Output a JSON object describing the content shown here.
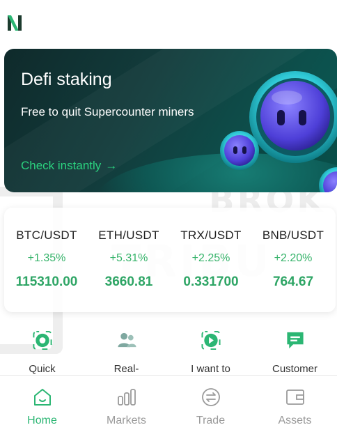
{
  "banner": {
    "title": "Defi staking",
    "subtitle": "Free to quit Supercounter miners",
    "link_label": "Check instantly",
    "link_arrow": "→"
  },
  "watermark": {
    "line1": "BROK",
    "line2": "TRIBU"
  },
  "ticker": {
    "pairs": [
      {
        "name": "BTC/USDT",
        "change": "+1.35%",
        "price": "115310.00"
      },
      {
        "name": "ETH/USDT",
        "change": "+5.31%",
        "price": "3660.81"
      },
      {
        "name": "TRX/USDT",
        "change": "+2.25%",
        "price": "0.331700"
      },
      {
        "name": "BNB/USDT",
        "change": "+2.20%",
        "price": "764.67"
      }
    ]
  },
  "actions": [
    {
      "label": "Quick",
      "icon": "quick-buy-icon"
    },
    {
      "label": "Real-",
      "icon": "real-name-icon"
    },
    {
      "label": "I want to",
      "icon": "i-want-to-icon"
    },
    {
      "label": "Customer",
      "icon": "customer-service-icon"
    }
  ],
  "nav": [
    {
      "label": "Home",
      "icon": "home-icon",
      "active": true
    },
    {
      "label": "Markets",
      "icon": "markets-icon",
      "active": false
    },
    {
      "label": "Trade",
      "icon": "trade-icon",
      "active": false
    },
    {
      "label": "Assets",
      "icon": "assets-icon",
      "active": false
    }
  ],
  "colors": {
    "accent": "#2bb673",
    "price_green": "#2ea565",
    "banner_bg": "#0f2a2b",
    "inactive_nav": "#9a9a9a"
  }
}
